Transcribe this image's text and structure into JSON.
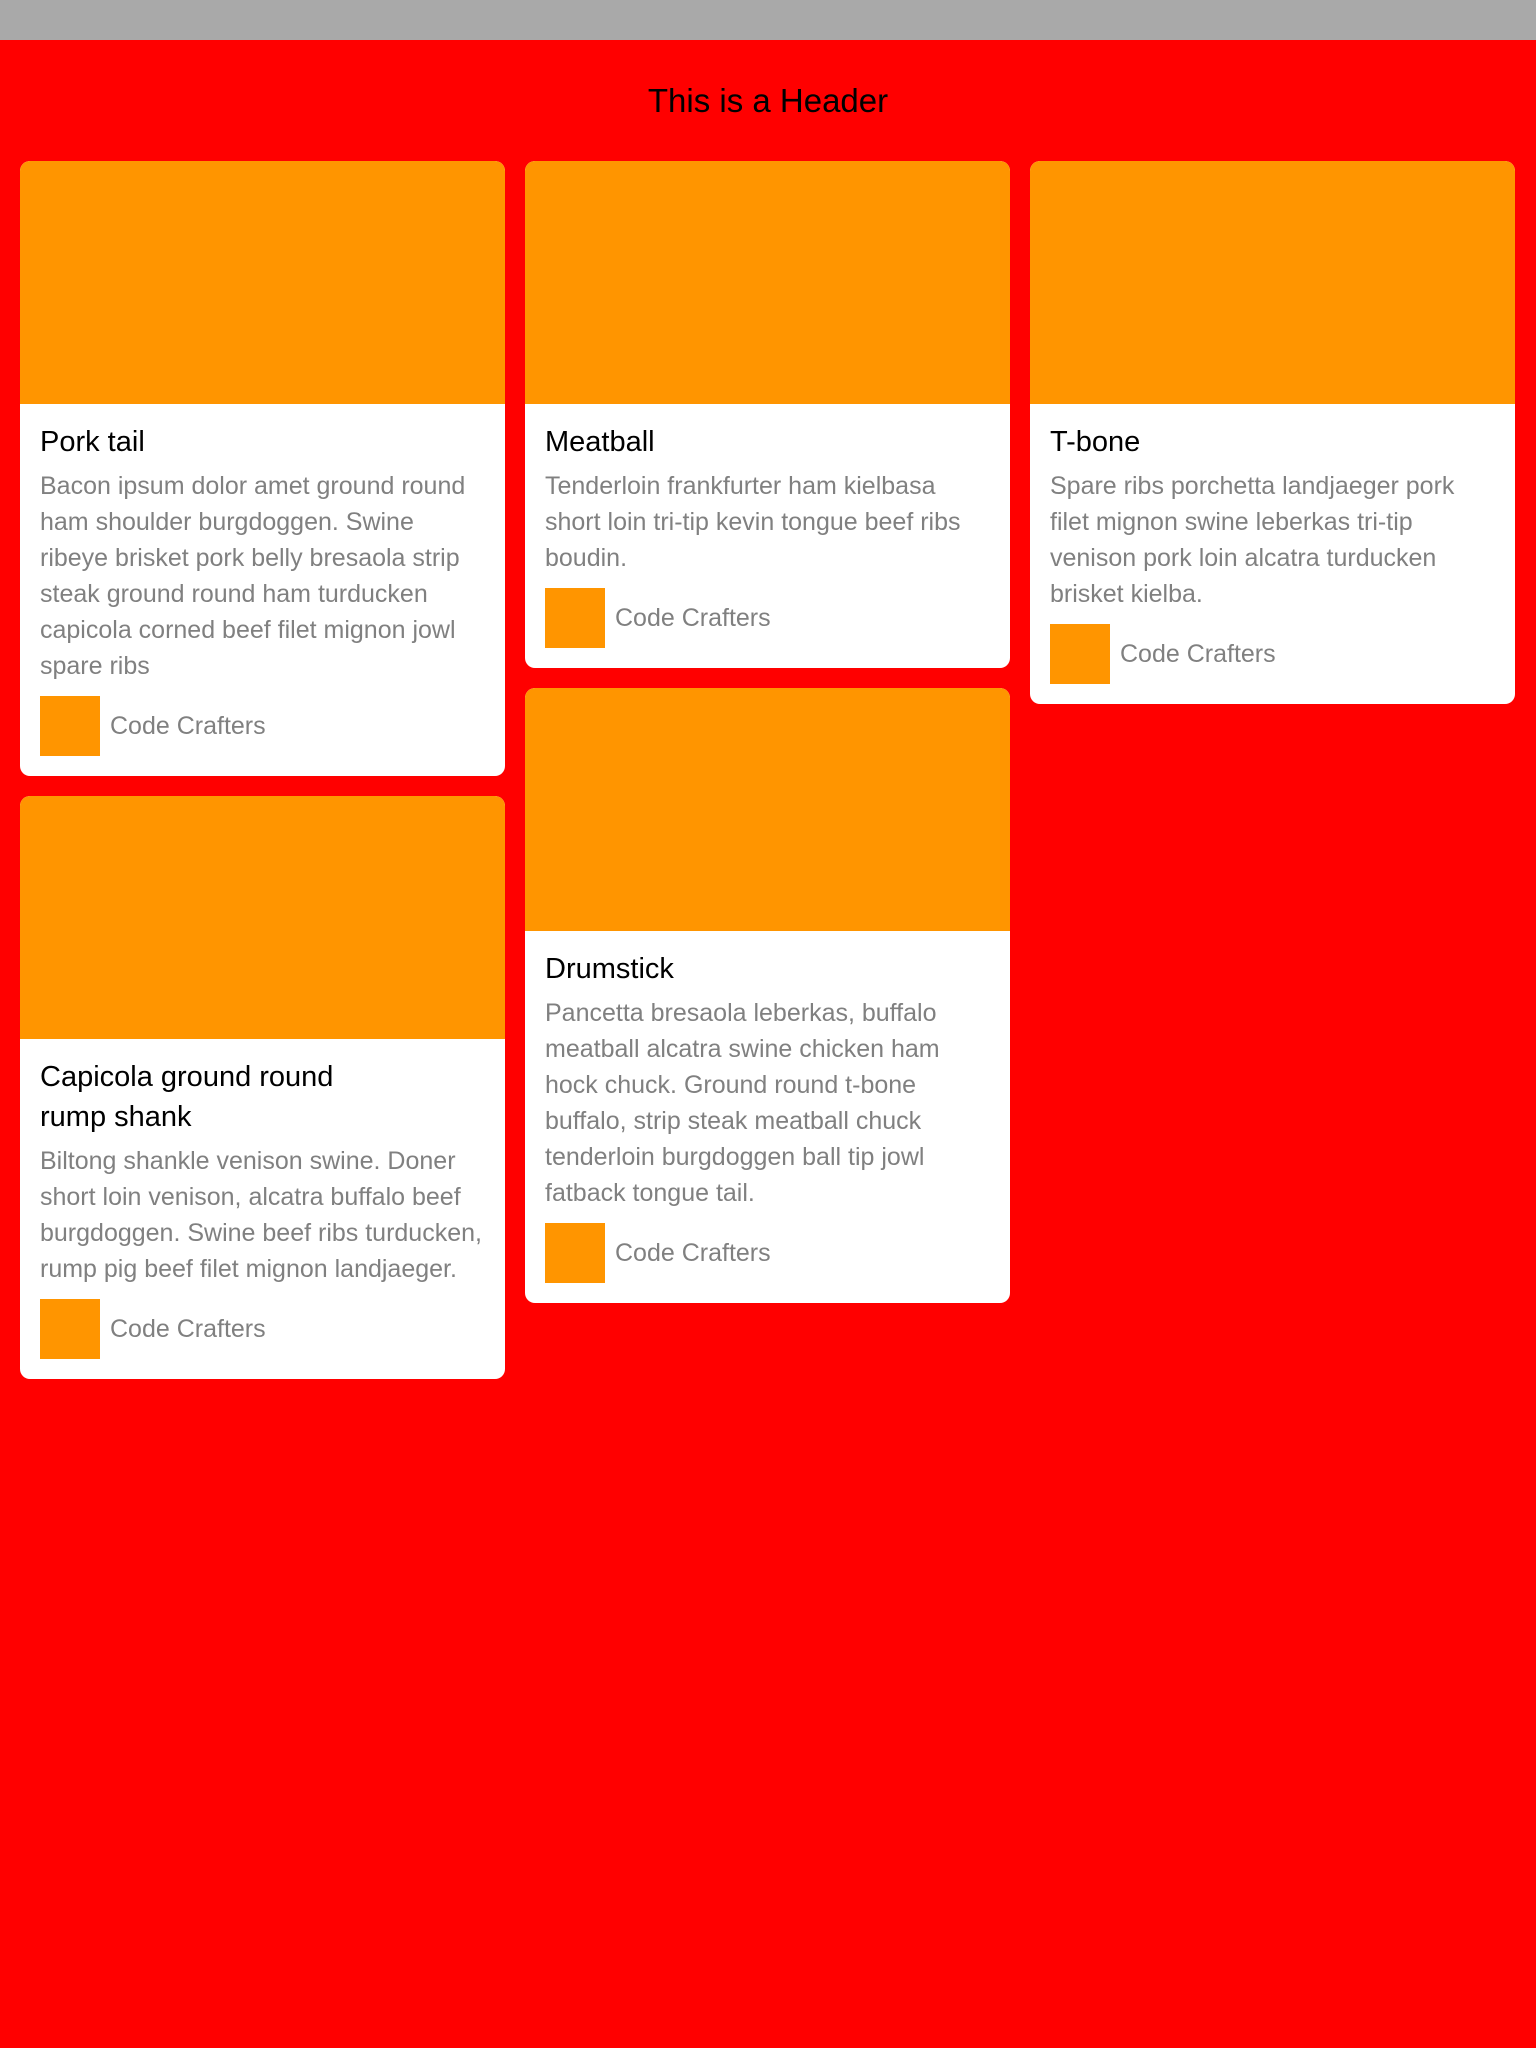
{
  "header": {
    "title": "This is a Header"
  },
  "colors": {
    "background": "#ff0000",
    "status_bar": "#a9a9a9",
    "accent": "#ff9500",
    "card": "#ffffff",
    "body_text": "#808080"
  },
  "cards": [
    {
      "title": "Pork tail",
      "text": "Bacon ipsum dolor amet ground round ham shoulder burgdoggen. Swine ribeye brisket pork belly bresaola strip steak ground round ham turducken capicola corned beef filet mignon jowl spare ribs",
      "author": "Code Crafters"
    },
    {
      "title": "Meatball",
      "text": "Tenderloin frankfurter ham kielbasa short loin tri-tip kevin tongue beef ribs boudin.",
      "author": "Code Crafters"
    },
    {
      "title": "T-bone",
      "text": "Spare ribs porchetta landjaeger pork filet mignon swine leberkas tri-tip venison pork loin alcatra turducken brisket kielba.",
      "author": "Code Crafters"
    },
    {
      "title": "Drumstick",
      "text": "Pancetta bresaola leberkas, buffalo meatball alcatra swine chicken ham hock chuck. Ground round t-bone buffalo, strip steak meatball chuck tenderloin burgdoggen ball tip jowl fatback tongue tail.",
      "author": "Code Crafters"
    },
    {
      "title": "Capicola ground round rump shank",
      "text": "Biltong shankle venison swine. Doner short loin venison, alcatra buffalo beef burgdoggen. Swine beef ribs turducken, rump pig beef filet mignon landjaeger.",
      "author": "Code Crafters"
    }
  ]
}
